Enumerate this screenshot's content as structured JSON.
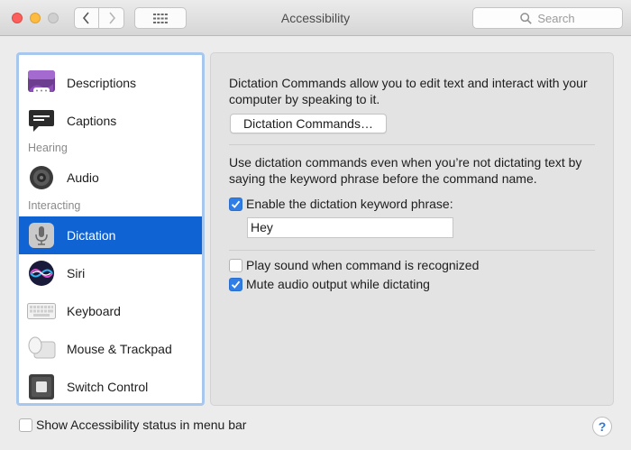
{
  "window": {
    "title": "Accessibility",
    "search_placeholder": "Search"
  },
  "sidebar": {
    "items": [
      {
        "label": "Descriptions",
        "icon": "descriptions-icon"
      },
      {
        "label": "Captions",
        "icon": "captions-icon"
      },
      {
        "label": "Audio",
        "icon": "speaker-icon"
      },
      {
        "label": "Dictation",
        "icon": "microphone-icon",
        "selected": true
      },
      {
        "label": "Siri",
        "icon": "siri-icon"
      },
      {
        "label": "Keyboard",
        "icon": "keyboard-icon"
      },
      {
        "label": "Mouse & Trackpad",
        "icon": "mouse-trackpad-icon"
      },
      {
        "label": "Switch Control",
        "icon": "switch-control-icon"
      }
    ],
    "section_headers": [
      "Hearing",
      "Interacting"
    ]
  },
  "main": {
    "intro_text": "Dictation Commands allow you to edit text and interact with your computer by speaking to it.",
    "commands_button": "Dictation Commands…",
    "keyword_description": "Use dictation commands even when you’re not dictating text by saying the keyword phrase before the command name.",
    "enable_keyword": {
      "label": "Enable the dictation keyword phrase:",
      "checked": true
    },
    "keyword_value": "Hey",
    "play_sound": {
      "label": "Play sound when command is recognized",
      "checked": false
    },
    "mute_audio": {
      "label": "Mute audio output while dictating",
      "checked": true
    }
  },
  "footer": {
    "status_menu": {
      "label": "Show Accessibility status in menu bar",
      "checked": false
    },
    "help": "?"
  },
  "colors": {
    "selection": "#0f63d3",
    "checkbox_on": "#2f7ee7",
    "sidebar_focus": "#a7c7ef"
  }
}
